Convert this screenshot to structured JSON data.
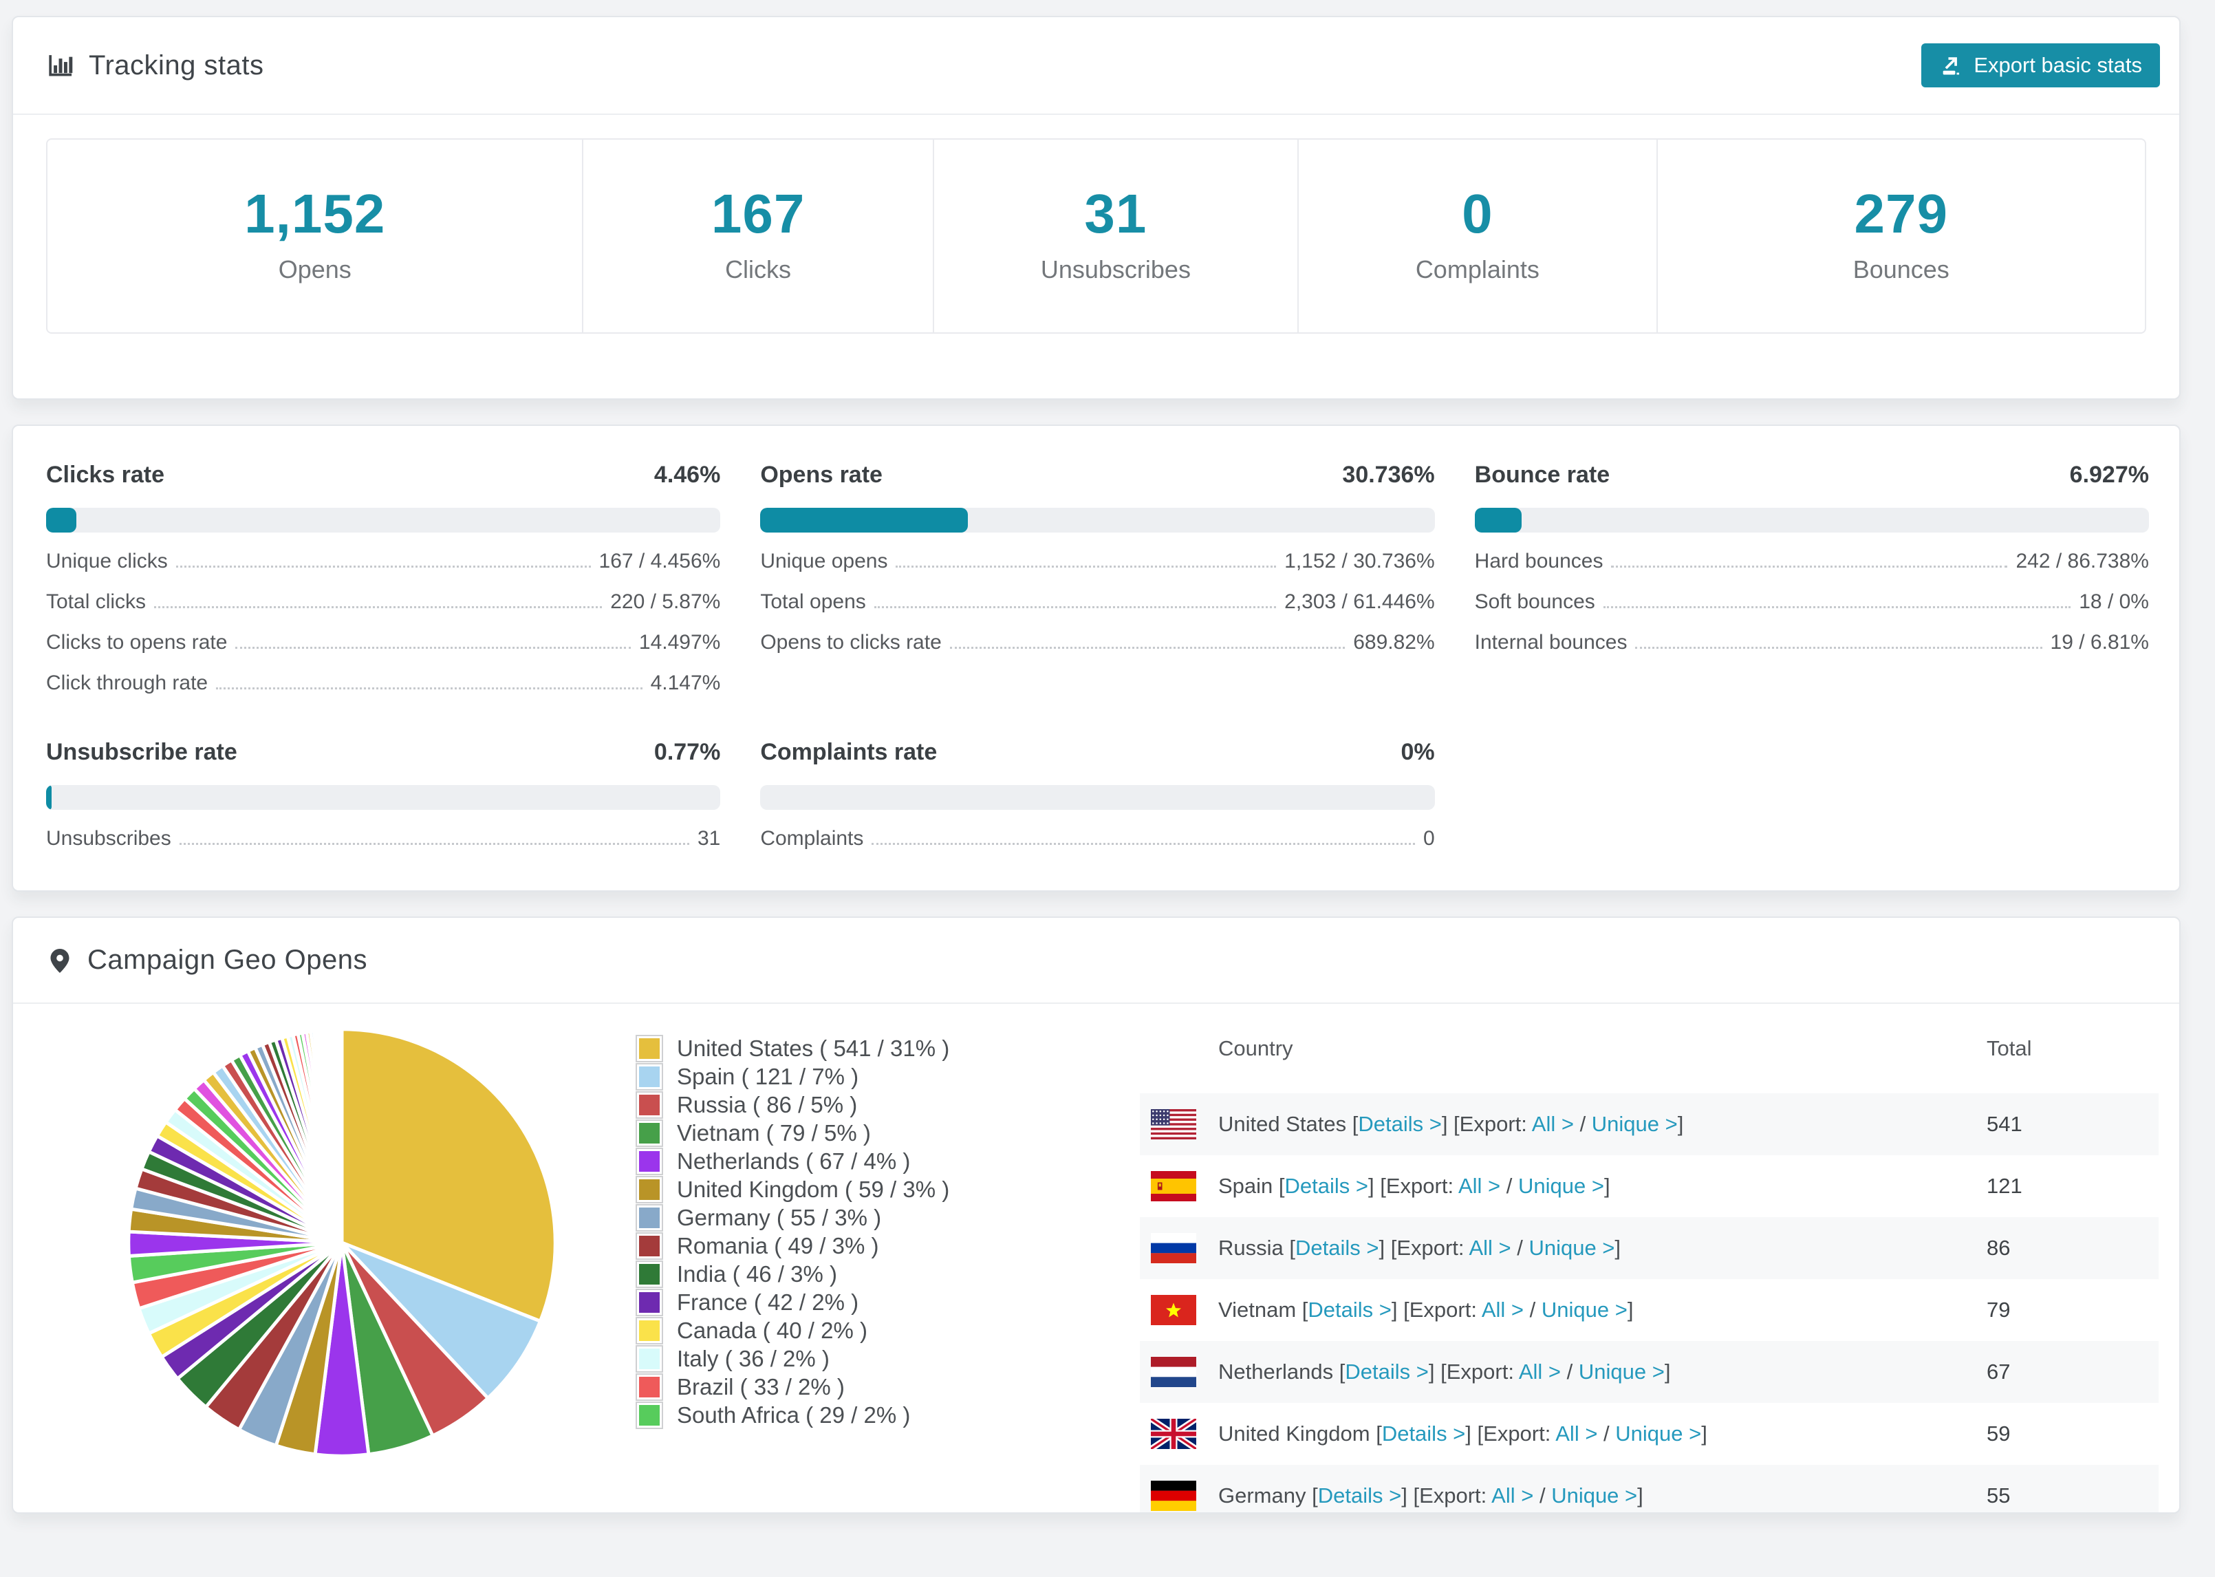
{
  "colors": {
    "accent": "#178ea6",
    "link": "#2599bd",
    "progress_fill": "#0e8ca4"
  },
  "tracking_card": {
    "title": "Tracking stats",
    "export_button_label": "Export basic stats",
    "stats": [
      {
        "value": "1,152",
        "label": "Opens"
      },
      {
        "value": "167",
        "label": "Clicks"
      },
      {
        "value": "31",
        "label": "Unsubscribes"
      },
      {
        "value": "0",
        "label": "Complaints"
      },
      {
        "value": "279",
        "label": "Bounces"
      }
    ]
  },
  "rates_card": {
    "sections": [
      {
        "title": "Clicks rate",
        "value": "4.46%",
        "percent": 4.46,
        "rows": [
          {
            "label": "Unique clicks",
            "value": "167 / 4.456%"
          },
          {
            "label": "Total clicks",
            "value": "220 / 5.87%"
          },
          {
            "label": "Clicks to opens rate",
            "value": "14.497%"
          },
          {
            "label": "Click through rate",
            "value": "4.147%"
          }
        ]
      },
      {
        "title": "Opens rate",
        "value": "30.736%",
        "percent": 30.736,
        "rows": [
          {
            "label": "Unique opens",
            "value": "1,152 / 30.736%"
          },
          {
            "label": "Total opens",
            "value": "2,303 / 61.446%"
          },
          {
            "label": "Opens to clicks rate",
            "value": "689.82%"
          }
        ]
      },
      {
        "title": "Bounce rate",
        "value": "6.927%",
        "percent": 6.927,
        "rows": [
          {
            "label": "Hard bounces",
            "value": "242 / 86.738%"
          },
          {
            "label": "Soft bounces",
            "value": "18 / 0%"
          },
          {
            "label": "Internal bounces",
            "value": "19 / 6.81%"
          }
        ]
      },
      {
        "title": "Unsubscribe rate",
        "value": "0.77%",
        "percent": 0.77,
        "rows": [
          {
            "label": "Unsubscribes",
            "value": "31"
          }
        ]
      },
      {
        "title": "Complaints rate",
        "value": "0%",
        "percent": 0,
        "rows": [
          {
            "label": "Complaints",
            "value": "0"
          }
        ]
      }
    ]
  },
  "geo_card": {
    "title": "Campaign Geo Opens",
    "table": {
      "headers": [
        "Country",
        "Total"
      ],
      "tokens": {
        "open_bracket": "[",
        "close_bracket": "]",
        "export_prefix": "Export:",
        "slash": "/"
      },
      "links": {
        "details": "Details >",
        "all": "All >",
        "unique": "Unique >"
      },
      "rows": [
        {
          "country": "United States",
          "flag": "us",
          "total": "541"
        },
        {
          "country": "Spain",
          "flag": "es",
          "total": "121"
        },
        {
          "country": "Russia",
          "flag": "ru",
          "total": "86"
        },
        {
          "country": "Vietnam",
          "flag": "vn",
          "total": "79"
        },
        {
          "country": "Netherlands",
          "flag": "nl",
          "total": "67"
        },
        {
          "country": "United Kingdom",
          "flag": "gb",
          "total": "59"
        },
        {
          "country": "Germany",
          "flag": "de",
          "total": "55"
        }
      ]
    }
  },
  "chart_data": {
    "type": "pie",
    "title": "Campaign Geo Opens",
    "unit": "opens",
    "start_angle": "top",
    "direction": "clockwise",
    "slice_gap_color": "#ffffff",
    "legend_position": "right",
    "slices": [
      {
        "label": "United States",
        "value": 541,
        "pct": 31,
        "color": "#e5bf3d"
      },
      {
        "label": "Spain",
        "value": 121,
        "pct": 7,
        "color": "#a8d4f0"
      },
      {
        "label": "Russia",
        "value": 86,
        "pct": 5,
        "color": "#c94f4f"
      },
      {
        "label": "Vietnam",
        "value": 79,
        "pct": 5,
        "color": "#46a049"
      },
      {
        "label": "Netherlands",
        "value": 67,
        "pct": 4,
        "color": "#9b35ec"
      },
      {
        "label": "United Kingdom",
        "value": 59,
        "pct": 3,
        "color": "#b99427"
      },
      {
        "label": "Germany",
        "value": 55,
        "pct": 3,
        "color": "#88a9c9"
      },
      {
        "label": "Romania",
        "value": 49,
        "pct": 3,
        "color": "#a43b3b"
      },
      {
        "label": "India",
        "value": 46,
        "pct": 3,
        "color": "#2f7a37"
      },
      {
        "label": "France",
        "value": 42,
        "pct": 2,
        "color": "#6e2ab0"
      },
      {
        "label": "Canada",
        "value": 40,
        "pct": 2,
        "color": "#fae24a"
      },
      {
        "label": "Italy",
        "value": 36,
        "pct": 2,
        "color": "#d8fbfb"
      },
      {
        "label": "Brazil",
        "value": 33,
        "pct": 2,
        "color": "#ef5a5a"
      },
      {
        "label": "South Africa",
        "value": 29,
        "pct": 2,
        "color": "#57cc5c"
      }
    ],
    "other_slices": {
      "note": "remaining unlabeled countries rendered as shrinking slivers",
      "weights": [
        1.5,
        1.4,
        1.3,
        1.25,
        1.15,
        1.1,
        1.0,
        0.95,
        0.9,
        0.85,
        0.8,
        0.75,
        0.7,
        0.65,
        0.6,
        0.55,
        0.5,
        0.48,
        0.45,
        0.42,
        0.4,
        0.37,
        0.34,
        0.31,
        0.28,
        0.26,
        0.24,
        0.22,
        0.2,
        0.18,
        0.16,
        0.14,
        0.13,
        0.12,
        0.11,
        0.1,
        0.09,
        0.08,
        0.07,
        0.06,
        0.05,
        0.05,
        0.04,
        0.04,
        0.03,
        0.03,
        0.02,
        0.02
      ],
      "palette": [
        "#9b35ec",
        "#b99427",
        "#88a9c9",
        "#a43b3b",
        "#2f7a37",
        "#6e2ab0",
        "#fae24a",
        "#d8fbfb",
        "#ef5a5a",
        "#57cc5c",
        "#e052e0",
        "#e5bf3d",
        "#a8d4f0",
        "#c94f4f",
        "#46a049"
      ]
    }
  }
}
